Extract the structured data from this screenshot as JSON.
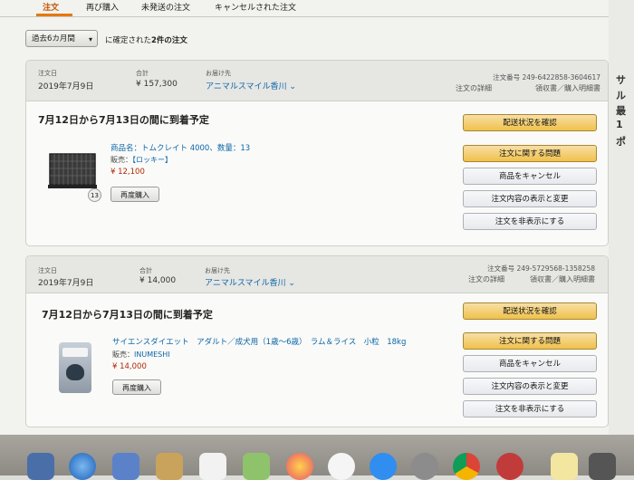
{
  "tabs": [
    "注文",
    "再び購入",
    "未発送の注文",
    "キャンセルされた注文"
  ],
  "filter": {
    "period": "過去6カ月間",
    "summary_prefix": "に確定された",
    "summary_count": "2件の注文"
  },
  "right_strip_chars": [
    "サ",
    "ル",
    "最",
    "1",
    "ポ"
  ],
  "orders": [
    {
      "date_label": "注文日",
      "date": "2019年7月9日",
      "total_label": "合計",
      "total": "¥ 157,300",
      "ship_label": "お届け先",
      "ship_to": "アニマルスマイル香川 ⌄",
      "order_no": "注文番号 249-6422858-3604617",
      "detail_link": "注文の詳細",
      "receipt_link": "領収書／購入明細書",
      "delivery": "7月12日から7月13日の間に到着予定",
      "product": "商品名：トムクレイト 4000、数量：13",
      "seller_prefix": "販売：",
      "seller": "【ロッキー】",
      "price": "¥ 12,100",
      "qty_badge": "13",
      "rebuy": "再度購入",
      "buttons": [
        "配送状況を確認",
        "注文に関する問題",
        "商品をキャンセル",
        "注文内容の表示と変更",
        "注文を非表示にする"
      ]
    },
    {
      "date_label": "注文日",
      "date": "2019年7月9日",
      "total_label": "合計",
      "total": "¥ 14,000",
      "ship_label": "お届け先",
      "ship_to": "アニマルスマイル香川 ⌄",
      "order_no": "注文番号 249-5729568-1358258",
      "detail_link": "注文の詳細",
      "receipt_link": "領収書／購入明細書",
      "delivery": "7月12日から7月13日の間に到着予定",
      "product": "サイエンスダイエット　アダルト／成犬用（1歳～6歳）　ラム＆ライス　小粒　18kg",
      "seller_prefix": "販売：",
      "seller": "INUMESHI",
      "price": "¥ 14,000",
      "rebuy": "再度購入",
      "buttons": [
        "配送状況を確認",
        "注文に関する問題",
        "商品をキャンセル",
        "注文内容の表示と変更",
        "注文を非表示にする"
      ]
    }
  ],
  "colors": {
    "accent": "#e47911",
    "link": "#0a66a8",
    "price": "#b12704",
    "yellow_button": "#f0c14b"
  }
}
